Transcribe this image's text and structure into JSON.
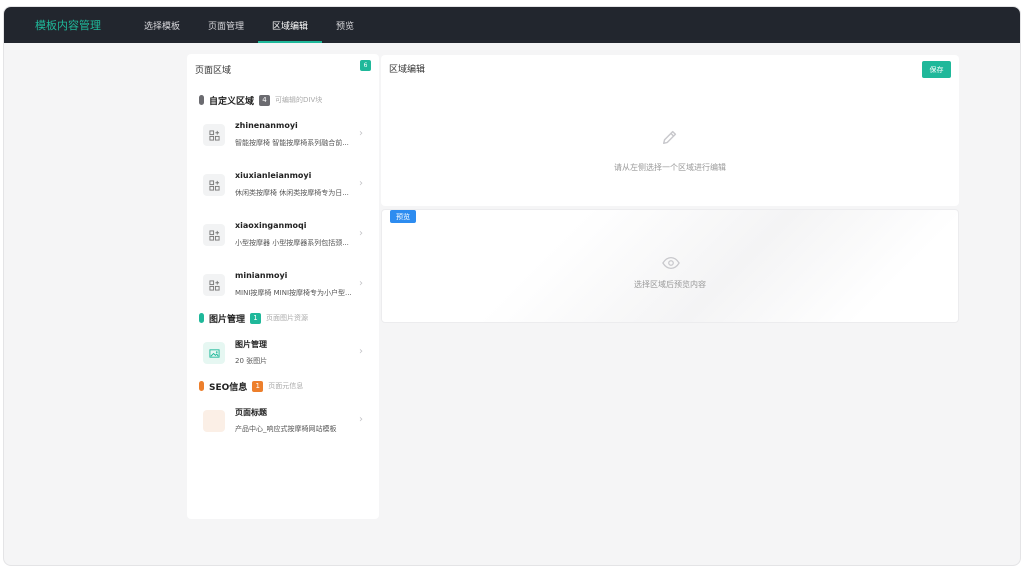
{
  "app": {
    "brand": "模板内容管理"
  },
  "nav": {
    "items": [
      {
        "label": "选择模板"
      },
      {
        "label": "页面管理"
      },
      {
        "label": "区域编辑"
      },
      {
        "label": "预览"
      }
    ],
    "active_index": 2
  },
  "left_panel": {
    "title": "页面区域",
    "count": "6",
    "sections": [
      {
        "title": "自定义区域",
        "badge": "4",
        "desc": "可编辑的DIV块",
        "color": "#6b6b70",
        "items": [
          {
            "name": "zhinenanmoyi",
            "desc": "智能按摩椅 智能按摩椅系列融合前...",
            "icon": "component-icon"
          },
          {
            "name": "xiuxianleianmoyi",
            "desc": "休闲类按摩椅 休闲类按摩椅专为日...",
            "icon": "component-icon"
          },
          {
            "name": "xiaoxinganmoqi",
            "desc": "小型按摩器 小型按摩器系列包括颈...",
            "icon": "component-icon"
          },
          {
            "name": "minianmoyi",
            "desc": "MINI按摩椅 MINI按摩椅专为小户型...",
            "icon": "component-icon"
          }
        ]
      },
      {
        "title": "图片管理",
        "badge": "1",
        "desc": "页面图片资源",
        "color": "#1fb89a",
        "items": [
          {
            "name": "图片管理",
            "desc": "20 张图片",
            "icon": "image-icon"
          }
        ]
      },
      {
        "title": "SEO信息",
        "badge": "1",
        "desc": "页面元信息",
        "color": "#ed7f2c",
        "items": [
          {
            "name": "页面标题",
            "desc": "产品中心_响应式按摩椅网站模板",
            "icon": "seo-icon"
          }
        ]
      }
    ]
  },
  "editor": {
    "title": "区域编辑",
    "save_label": "保存",
    "empty_hint": "请从左侧选择一个区域进行编辑",
    "icon": "pencil-icon"
  },
  "preview": {
    "tag": "预览",
    "empty_hint": "选择区域后预览内容",
    "icon": "eye-icon"
  }
}
